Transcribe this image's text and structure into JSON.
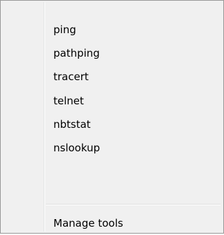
{
  "menu": {
    "items": [
      {
        "label": "ping"
      },
      {
        "label": "pathping"
      },
      {
        "label": "tracert"
      },
      {
        "label": "telnet"
      },
      {
        "label": "nbtstat"
      },
      {
        "label": "nslookup"
      }
    ],
    "manage_label": "Manage tools"
  }
}
